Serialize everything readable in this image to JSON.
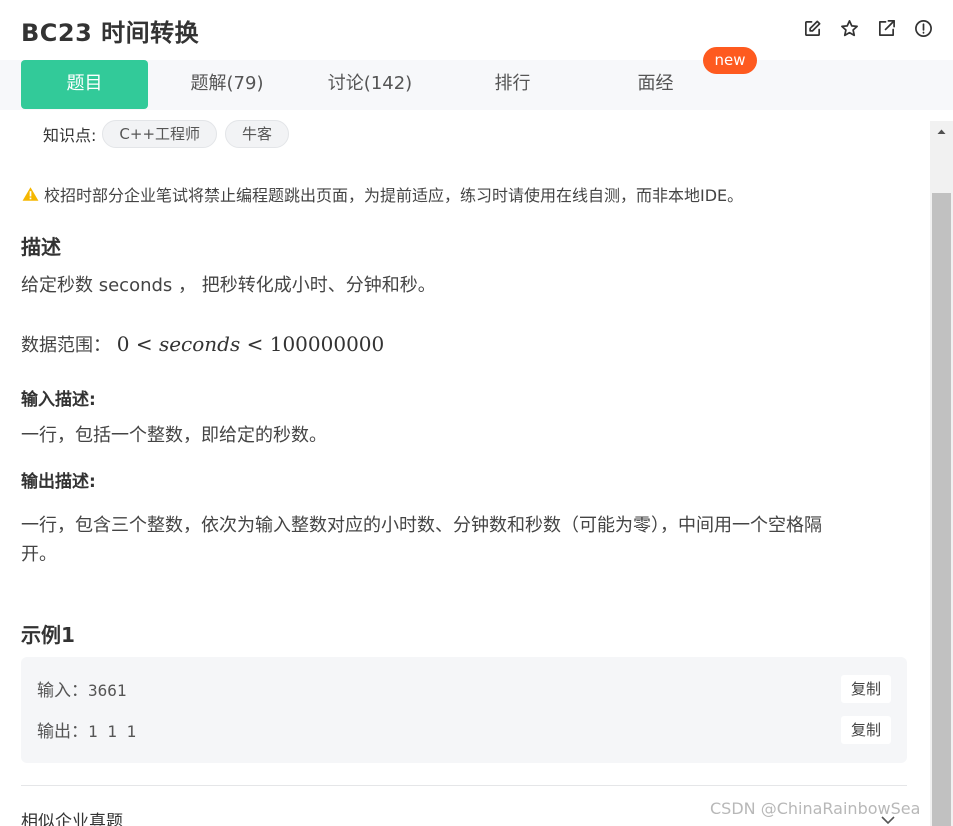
{
  "header": {
    "title": "BC23  时间转换",
    "icons": [
      "edit-icon",
      "star-icon",
      "external-link-icon",
      "alert-circle-icon"
    ]
  },
  "tabs": [
    {
      "label": "题目",
      "active": true
    },
    {
      "label": "题解(79)",
      "active": false
    },
    {
      "label": "讨论(142)",
      "active": false
    },
    {
      "label": "排行",
      "active": false
    },
    {
      "label": "面经",
      "active": false
    }
  ],
  "new_badge": "new",
  "knowledge": {
    "label": "知识点:",
    "tags": [
      "C++工程师",
      "牛客"
    ]
  },
  "warning": "校招时部分企业笔试将禁止编程题跳出页面，为提前适应，练习时请使用在线自测，而非本地IDE。",
  "description": {
    "heading": "描述",
    "text": "给定秒数 seconds ， 把秒转化成小时、分钟和秒。",
    "range_label": "数据范围：",
    "range_lower": "0",
    "range_var": "seconds",
    "range_upper": "100000000"
  },
  "input_desc": {
    "heading": "输入描述:",
    "text": "一行，包括一个整数，即给定的秒数。"
  },
  "output_desc": {
    "heading": "输出描述:",
    "line1": "一行，包含三个整数，依次为输入整数对应的小时数、分钟数和秒数（可能为零），中间用一个空格隔",
    "line2": "开。"
  },
  "example": {
    "heading": "示例1",
    "input_label": "输入：",
    "input_value": "3661",
    "output_label": "输出：",
    "output_value": "1 1 1",
    "copy_label": "复制"
  },
  "similar": "相似企业真题",
  "watermark": "CSDN @ChinaRainbowSea",
  "colors": {
    "accent": "#32ca99",
    "badge": "#fe5a1f",
    "warning": "#f5b700"
  }
}
